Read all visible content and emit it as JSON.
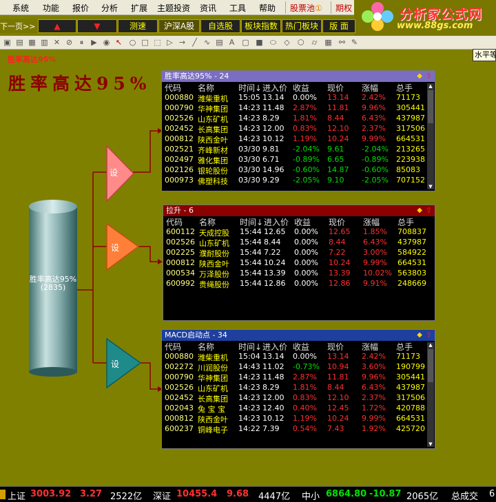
{
  "menu": {
    "items": [
      "系统",
      "功能",
      "报价",
      "分析",
      "扩展",
      "主题投资",
      "资讯",
      "工具",
      "帮助"
    ],
    "stock_pool": "股票池",
    "stock_pool_badge": "①",
    "options": "期权"
  },
  "logo": {
    "text": "分析家公式网",
    "url": "www.88gs.com"
  },
  "navbar": {
    "prev": "下一页>>",
    "buttons": [
      "▲",
      "▼",
      "测速",
      "沪深A股",
      "自选股",
      "板块指数",
      "热门板块",
      "版 面"
    ]
  },
  "tooltip": "水平等",
  "page_label": "胜率高达95%",
  "big_title": "胜率高达95%",
  "cylinder": {
    "label": "胜率高达95%",
    "count": "(2835)"
  },
  "triangles": [
    "设",
    "设",
    "设"
  ],
  "columns": [
    "代码",
    "名称",
    "时间↓",
    "进入价",
    "收益",
    "现价",
    "涨幅",
    "总手"
  ],
  "panels": [
    {
      "title": "胜率高达95% - 24",
      "header_color": "#7b6ec2",
      "rows": [
        {
          "code": "000880",
          "name": "潍柴重机",
          "time": "15:05",
          "entry": "13.14",
          "gain": "0.00%",
          "price": "13.14",
          "chg": "2.42%",
          "vol": "71173",
          "gd": "flat",
          "pd": "up"
        },
        {
          "code": "000790",
          "name": "华神集团",
          "time": "14:23",
          "entry": "11.48",
          "gain": "2.87%",
          "price": "11.81",
          "chg": "9.96%",
          "vol": "305441",
          "gd": "up",
          "pd": "up"
        },
        {
          "code": "002526",
          "name": "山东矿机",
          "time": "14:23",
          "entry": "8.29",
          "gain": "1.81%",
          "price": "8.44",
          "chg": "6.43%",
          "vol": "437987",
          "gd": "up",
          "pd": "up"
        },
        {
          "code": "002452",
          "name": "长高集团",
          "time": "14:23",
          "entry": "12.00",
          "gain": "0.83%",
          "price": "12.10",
          "chg": "2.37%",
          "vol": "317506",
          "gd": "up",
          "pd": "up"
        },
        {
          "code": "000812",
          "name": "陕西金叶",
          "time": "14:23",
          "entry": "10.12",
          "gain": "1.19%",
          "price": "10.24",
          "chg": "9.99%",
          "vol": "664531",
          "gd": "up",
          "pd": "up"
        },
        {
          "code": "002521",
          "name": "齐峰新材",
          "time": "03/30",
          "entry": "9.81",
          "gain": "-2.04%",
          "price": "9.61",
          "chg": "-2.04%",
          "vol": "213265",
          "gd": "dn",
          "pd": "dn"
        },
        {
          "code": "002497",
          "name": "雅化集团",
          "time": "03/30",
          "entry": "6.71",
          "gain": "-0.89%",
          "price": "6.65",
          "chg": "-0.89%",
          "vol": "223938",
          "gd": "dn",
          "pd": "dn"
        },
        {
          "code": "002126",
          "name": "银轮股份",
          "time": "03/30",
          "entry": "14.96",
          "gain": "-0.60%",
          "price": "14.87",
          "chg": "-0.60%",
          "vol": "85083",
          "gd": "dn",
          "pd": "dn"
        },
        {
          "code": "000973",
          "name": "佛塑科技",
          "time": "03/30",
          "entry": "9.29",
          "gain": "-2.05%",
          "price": "9.10",
          "chg": "-2.05%",
          "vol": "707152",
          "gd": "dn",
          "pd": "dn"
        }
      ]
    },
    {
      "title": "拉升 - 6",
      "header_color": "#8b0000",
      "rows": [
        {
          "code": "600112",
          "name": "天成控股",
          "time": "15:44",
          "entry": "12.65",
          "gain": "0.00%",
          "price": "12.65",
          "chg": "1.85%",
          "vol": "708837",
          "gd": "flat",
          "pd": "up"
        },
        {
          "code": "002526",
          "name": "山东矿机",
          "time": "15:44",
          "entry": "8.44",
          "gain": "0.00%",
          "price": "8.44",
          "chg": "6.43%",
          "vol": "437987",
          "gd": "flat",
          "pd": "up"
        },
        {
          "code": "002225",
          "name": "濮耐股份",
          "time": "15:44",
          "entry": "7.22",
          "gain": "0.00%",
          "price": "7.22",
          "chg": "3.00%",
          "vol": "584922",
          "gd": "flat",
          "pd": "up"
        },
        {
          "code": "000812",
          "name": "陕西金叶",
          "time": "15:44",
          "entry": "10.24",
          "gain": "0.00%",
          "price": "10.24",
          "chg": "9.99%",
          "vol": "664531",
          "gd": "flat",
          "pd": "up"
        },
        {
          "code": "000534",
          "name": "万泽股份",
          "time": "15:44",
          "entry": "13.39",
          "gain": "0.00%",
          "price": "13.39",
          "chg": "10.02%",
          "vol": "563803",
          "gd": "flat",
          "pd": "up"
        },
        {
          "code": "600992",
          "name": "贵绳股份",
          "time": "15:44",
          "entry": "12.86",
          "gain": "0.00%",
          "price": "12.86",
          "chg": "9.91%",
          "vol": "248669",
          "gd": "flat",
          "pd": "up"
        }
      ]
    },
    {
      "title": "MACD启动点 - 34",
      "header_color": "#1e3f9e",
      "rows": [
        {
          "code": "000880",
          "name": "潍柴重机",
          "time": "15:04",
          "entry": "13.14",
          "gain": "0.00%",
          "price": "13.14",
          "chg": "2.42%",
          "vol": "71173",
          "gd": "flat",
          "pd": "up"
        },
        {
          "code": "002272",
          "name": "川润股份",
          "time": "14:43",
          "entry": "11.02",
          "gain": "-0.73%",
          "price": "10.94",
          "chg": "3.60%",
          "vol": "190799",
          "gd": "dn",
          "pd": "up"
        },
        {
          "code": "000790",
          "name": "华神集团",
          "time": "14:23",
          "entry": "11.48",
          "gain": "2.87%",
          "price": "11.81",
          "chg": "9.96%",
          "vol": "305441",
          "gd": "up",
          "pd": "up"
        },
        {
          "code": "002526",
          "name": "山东矿机",
          "time": "14:23",
          "entry": "8.29",
          "gain": "1.81%",
          "price": "8.44",
          "chg": "6.43%",
          "vol": "437987",
          "gd": "up",
          "pd": "up"
        },
        {
          "code": "002452",
          "name": "长高集团",
          "time": "14:23",
          "entry": "12.00",
          "gain": "0.83%",
          "price": "12.10",
          "chg": "2.37%",
          "vol": "317506",
          "gd": "up",
          "pd": "up"
        },
        {
          "code": "002043",
          "name": "兔 宝 宝",
          "time": "14:23",
          "entry": "12.40",
          "gain": "0.40%",
          "price": "12.45",
          "chg": "1.72%",
          "vol": "420788",
          "gd": "up",
          "pd": "up"
        },
        {
          "code": "000812",
          "name": "陕西金叶",
          "time": "14:23",
          "entry": "10.12",
          "gain": "1.19%",
          "price": "10.24",
          "chg": "9.99%",
          "vol": "664531",
          "gd": "up",
          "pd": "up"
        },
        {
          "code": "600237",
          "name": "铜峰电子",
          "time": "14:22",
          "entry": "7.39",
          "gain": "0.54%",
          "price": "7.43",
          "chg": "1.92%",
          "vol": "425720",
          "gd": "up",
          "pd": "up"
        }
      ]
    }
  ],
  "statusbar": {
    "sh_label": "上证",
    "sh_value": "3003.92",
    "sh_change": "3.27",
    "sh_amount": "2522亿",
    "sz_label": "深证",
    "sz_value": "10455.4",
    "sz_change": "9.68",
    "sz_amount": "4447亿",
    "zx_label": "中小",
    "zx_value": "6864.80",
    "zx_change": "-10.87",
    "zx_amount": "2065亿",
    "total_label": "总成交",
    "total_value": "6"
  }
}
